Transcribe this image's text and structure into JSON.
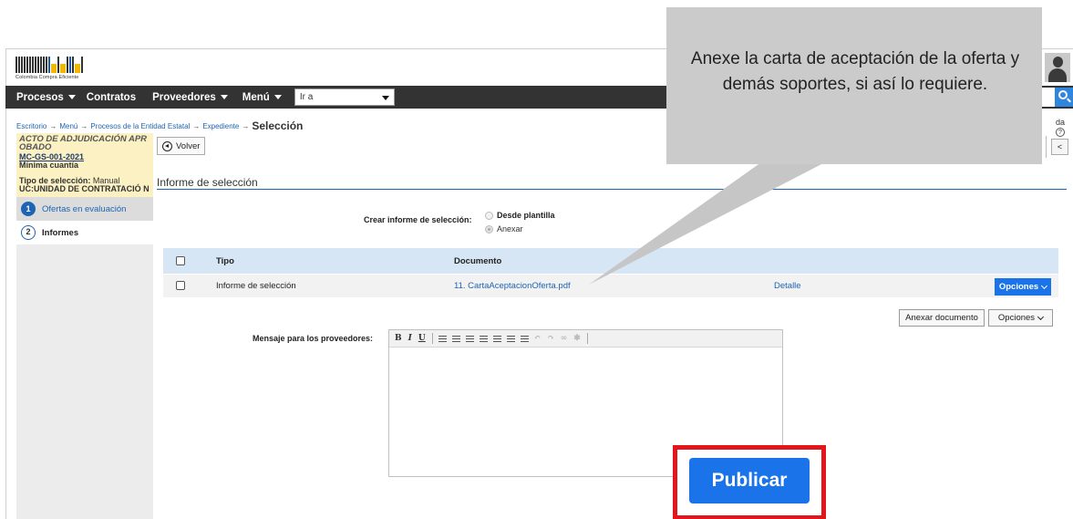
{
  "logo": {
    "text": "Colombia Compra Eficiente"
  },
  "nav": {
    "items": [
      "Procesos",
      "Contratos",
      "Proveedores",
      "Menú"
    ],
    "goto_value": "Ir a"
  },
  "breadcrumb": {
    "items": [
      "Escritorio",
      "Menú",
      "Procesos de la Entidad Estatal",
      "Expediente"
    ],
    "arrow": "→",
    "current": "Selección"
  },
  "help": {
    "label": "da",
    "icon": "?"
  },
  "prev_button": "<",
  "process": {
    "status": "ACTO DE ADJUDICACIÓN APR OBADO",
    "code": "MC-GS-001-2021",
    "modality": "Mínima cuantía",
    "selection_type_label": "Tipo de selección:",
    "selection_type_value": "Manual",
    "unit": "UC:UNIDAD DE CONTRATACIÓ N"
  },
  "steps": [
    {
      "number": "1",
      "label": "Ofertas en evaluación"
    },
    {
      "number": "2",
      "label": "Informes"
    }
  ],
  "volver_label": "Volver",
  "section": {
    "title": "Informe de selección",
    "create_label": "Crear informe de selección:",
    "options": [
      "Desde plantilla",
      "Anexar"
    ]
  },
  "table": {
    "headers": [
      "Tipo",
      "Documento"
    ],
    "rows": [
      {
        "tipo": "Informe de selección",
        "documento": "11. CartaAceptacionOferta.pdf",
        "detalle": "Detalle",
        "opciones": "Opciones"
      }
    ]
  },
  "actions": {
    "anexar": "Anexar documento",
    "opciones": "Opciones"
  },
  "message": {
    "label": "Mensaje para los proveedores:",
    "toolbar": [
      "B",
      "I",
      "U"
    ]
  },
  "publicar_label": "Publicar",
  "callout": {
    "text": "Anexe la carta de aceptación de la oferta y demás soportes, si así lo requiere."
  },
  "colors": {
    "primary_blue": "#1a73e8",
    "nav_bg": "#333333",
    "highlight_red": "#e3161b",
    "sidebar_yellow": "#fbf1c2",
    "table_header": "#d6e6f5"
  }
}
